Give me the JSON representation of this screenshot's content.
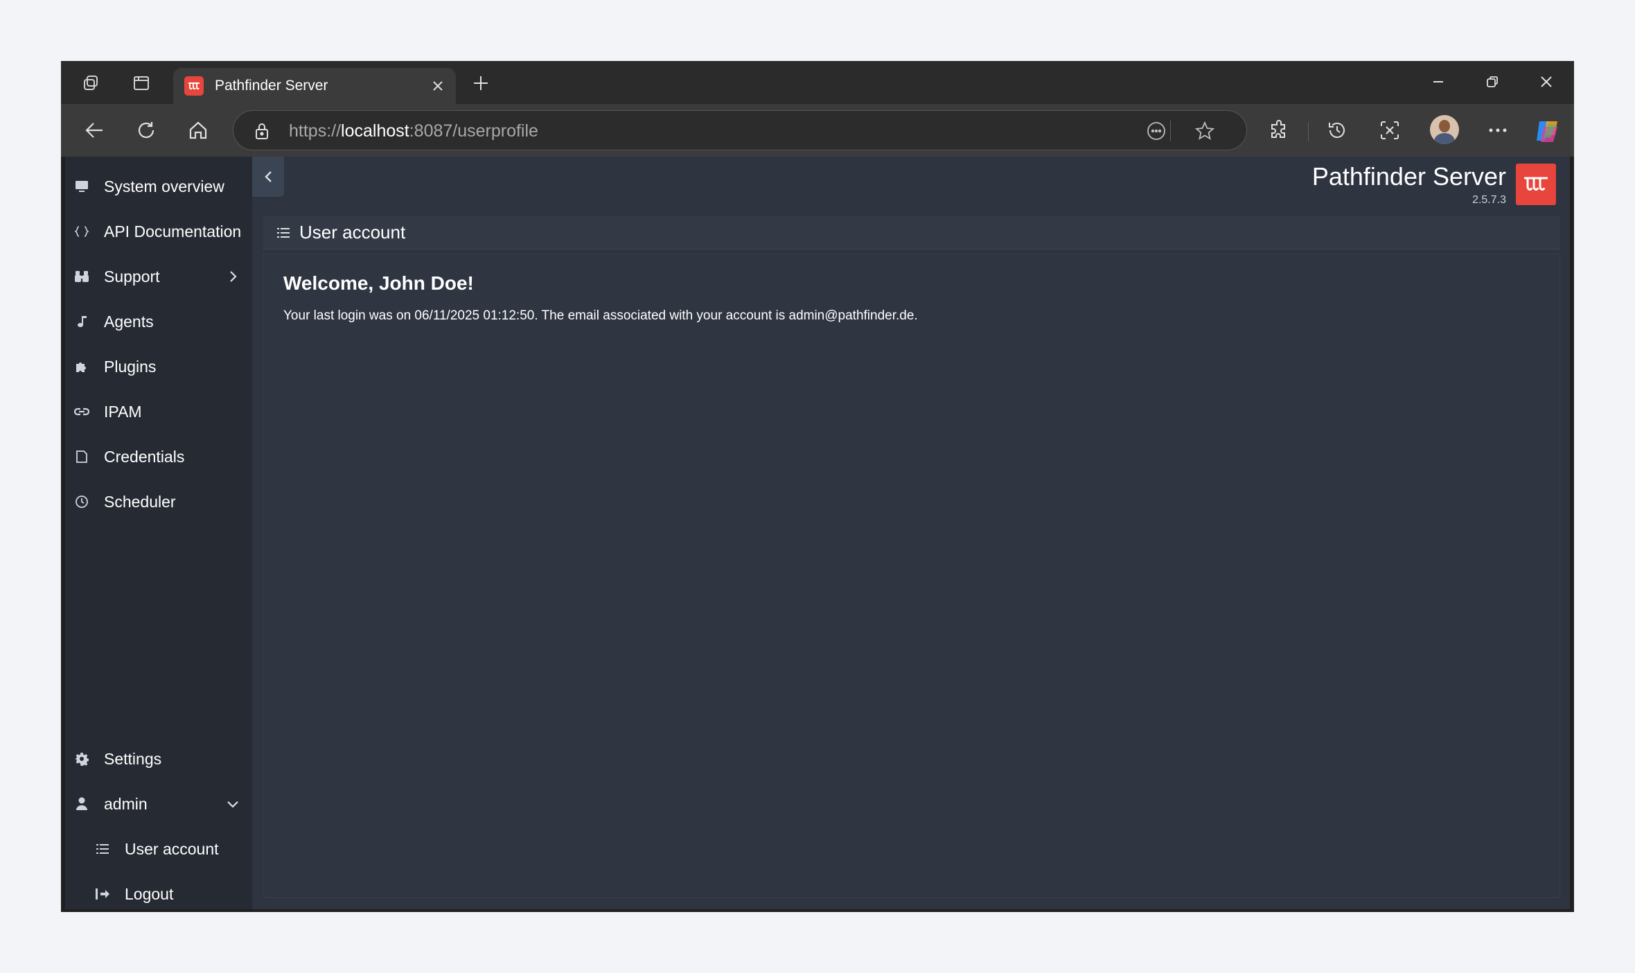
{
  "browser": {
    "tab_title": "Pathfinder Server",
    "url_scheme": "https://",
    "url_host": "localhost",
    "url_rest": ":8087/userprofile"
  },
  "sidebar": {
    "items": [
      {
        "label": "System overview",
        "icon": "monitor-icon"
      },
      {
        "label": "API Documentation",
        "icon": "braces-icon"
      },
      {
        "label": "Support",
        "icon": "binoculars-icon"
      },
      {
        "label": "Agents",
        "icon": "music-note-icon"
      },
      {
        "label": "Plugins",
        "icon": "puzzle-icon"
      },
      {
        "label": "IPAM",
        "icon": "link-icon"
      },
      {
        "label": "Credentials",
        "icon": "file-icon"
      },
      {
        "label": "Scheduler",
        "icon": "clock-icon"
      }
    ],
    "bottom": {
      "settings": "Settings",
      "user": "admin",
      "user_account": "User account",
      "logout": "Logout"
    }
  },
  "brand": {
    "name": "Pathfinder Server",
    "version": "2.5.7.3",
    "color": "#e8453c"
  },
  "main": {
    "header": "User account",
    "welcome": "Welcome, John Doe!",
    "info": "Your last login was on 06/11/2025 01:12:50. The email associated with your account is admin@pathfinder.de."
  }
}
